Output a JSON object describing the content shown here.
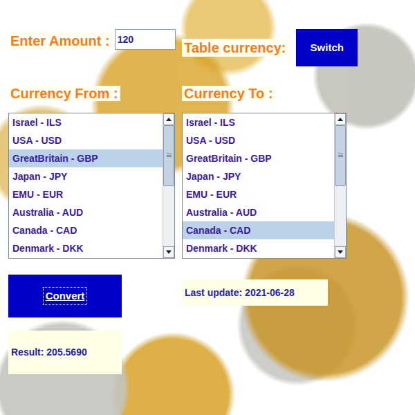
{
  "amount": {
    "label": "Enter Amount :",
    "value": "120"
  },
  "table_currency": {
    "label": "Table currency:"
  },
  "switch_button": "Switch",
  "from": {
    "label": "Currency From :",
    "items": [
      {
        "label": "Israel - ILS",
        "selected": false
      },
      {
        "label": "USA - USD",
        "selected": false
      },
      {
        "label": "GreatBritain - GBP",
        "selected": true
      },
      {
        "label": "Japan - JPY",
        "selected": false
      },
      {
        "label": "EMU - EUR",
        "selected": false
      },
      {
        "label": "Australia - AUD",
        "selected": false
      },
      {
        "label": "Canada - CAD",
        "selected": false
      },
      {
        "label": "Denmark - DKK",
        "selected": false
      }
    ],
    "scrollbar": {
      "level": 0.5
    }
  },
  "to": {
    "label": "Currency To :",
    "items": [
      {
        "label": "Israel - ILS",
        "selected": false
      },
      {
        "label": "USA - USD",
        "selected": false
      },
      {
        "label": "GreatBritain - GBP",
        "selected": false
      },
      {
        "label": "Japan - JPY",
        "selected": false
      },
      {
        "label": "EMU - EUR",
        "selected": false
      },
      {
        "label": "Australia - AUD",
        "selected": false
      },
      {
        "label": "Canada - CAD",
        "selected": true
      },
      {
        "label": "Denmark - DKK",
        "selected": false
      }
    ],
    "scrollbar": {
      "level": 0.5
    }
  },
  "convert_button": "Convert",
  "last_update": "Last update: 2021-06-28",
  "result": "Result: 205.5690"
}
